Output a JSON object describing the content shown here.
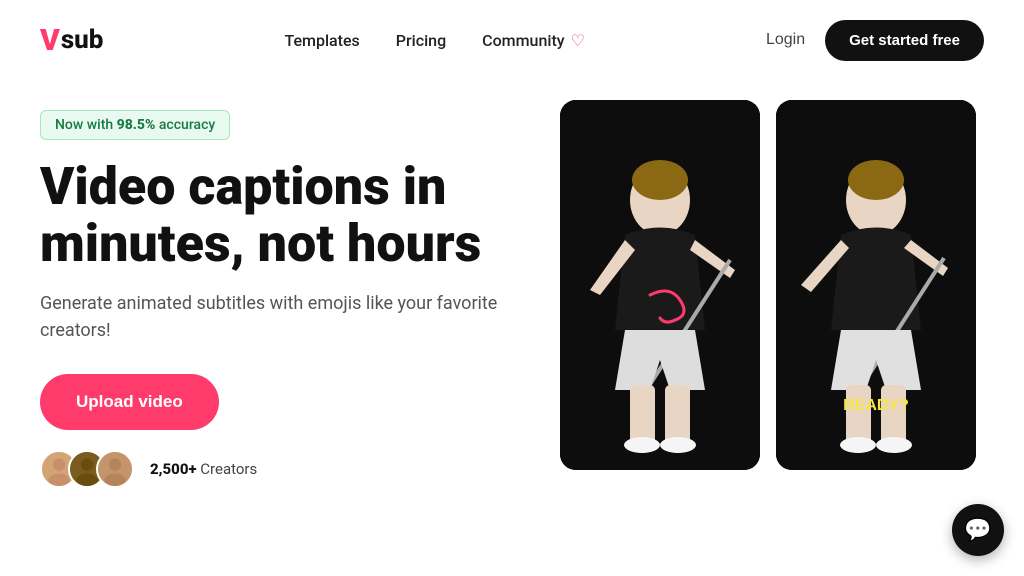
{
  "brand": {
    "logo_v": "V",
    "logo_text": "sub"
  },
  "nav": {
    "links": [
      {
        "label": "Templates",
        "id": "templates"
      },
      {
        "label": "Pricing",
        "id": "pricing"
      },
      {
        "label": "Community",
        "id": "community"
      }
    ],
    "login_label": "Login",
    "cta_label": "Get started free"
  },
  "hero": {
    "badge_prefix": "Now with ",
    "badge_accent": "98.5%",
    "badge_suffix": " accuracy",
    "title": "Video captions in minutes, not hours",
    "subtitle": "Generate animated subtitles with emojis like your favorite creators!",
    "upload_label": "Upload video",
    "creators_count": "2,500+",
    "creators_label": "Creators"
  },
  "videos": [
    {
      "id": "video-1",
      "label": ""
    },
    {
      "id": "video-2",
      "label": "READY?"
    }
  ],
  "chat": {
    "icon": "💬"
  }
}
